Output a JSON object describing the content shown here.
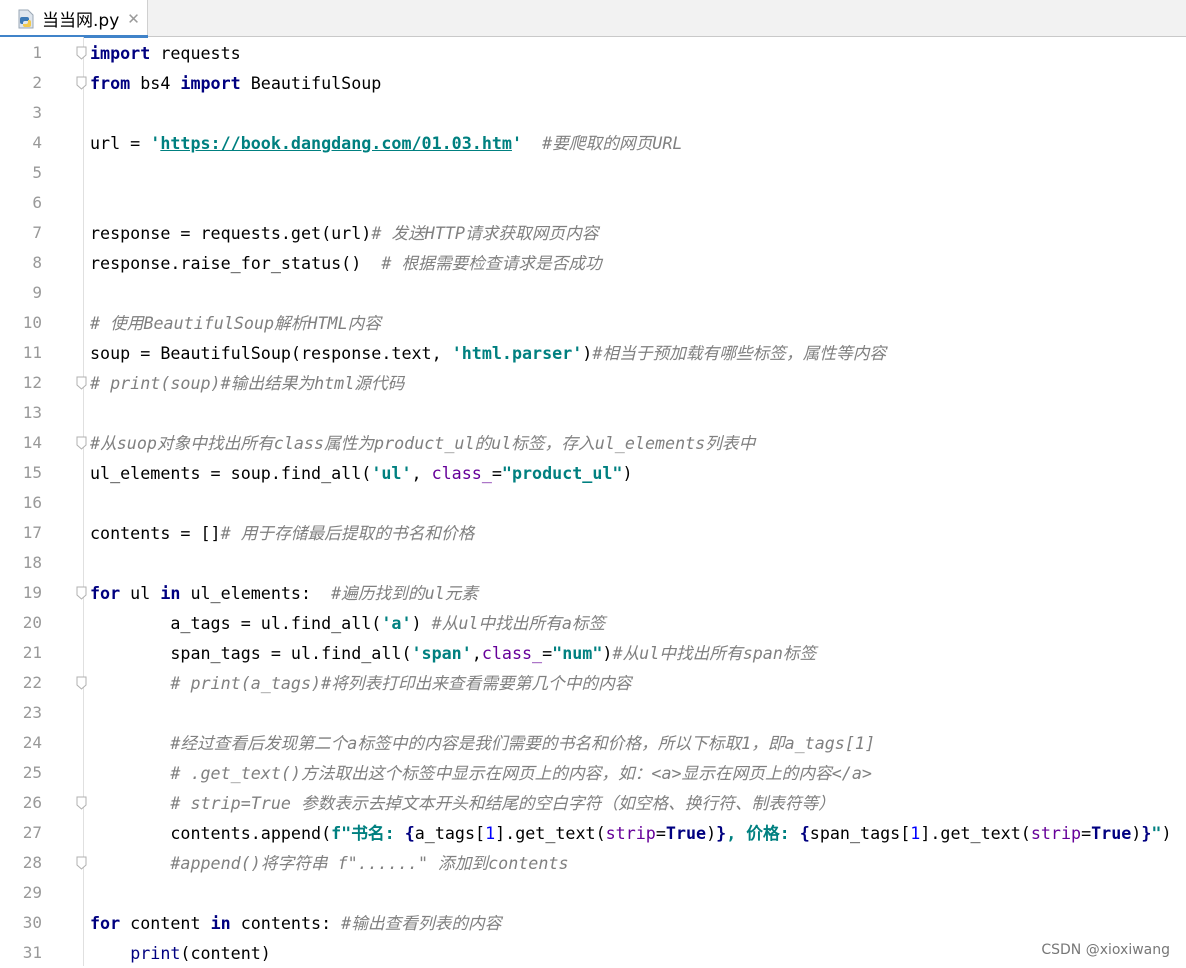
{
  "tab": {
    "title": "当当网.py",
    "icon": "python-file-icon"
  },
  "watermark": "CSDN @xioxiwang",
  "lines": [
    {
      "n": "1",
      "fold": true,
      "parts": [
        {
          "c": "kw",
          "t": "import"
        },
        {
          "c": "",
          "t": " requests"
        }
      ]
    },
    {
      "n": "2",
      "fold": true,
      "parts": [
        {
          "c": "kw",
          "t": "from"
        },
        {
          "c": "",
          "t": " bs4 "
        },
        {
          "c": "kw",
          "t": "import"
        },
        {
          "c": "",
          "t": " BeautifulSoup"
        }
      ]
    },
    {
      "n": "3",
      "fold": false,
      "parts": []
    },
    {
      "n": "4",
      "fold": false,
      "parts": [
        {
          "c": "",
          "t": "url = "
        },
        {
          "c": "str",
          "t": "'"
        },
        {
          "c": "url",
          "t": "https://book.dangdang.com/01.03.htm"
        },
        {
          "c": "str",
          "t": "'"
        },
        {
          "c": "",
          "t": "  "
        },
        {
          "c": "cm",
          "t": "#要爬取的网页URL"
        }
      ]
    },
    {
      "n": "5",
      "fold": false,
      "parts": []
    },
    {
      "n": "6",
      "fold": false,
      "parts": []
    },
    {
      "n": "7",
      "fold": false,
      "parts": [
        {
          "c": "",
          "t": "response = requests.get(url)"
        },
        {
          "c": "cm",
          "t": "# 发送HTTP请求获取网页内容"
        }
      ]
    },
    {
      "n": "8",
      "fold": false,
      "parts": [
        {
          "c": "",
          "t": "response.raise_for_status()  "
        },
        {
          "c": "cm",
          "t": "# 根据需要检查请求是否成功"
        }
      ]
    },
    {
      "n": "9",
      "fold": false,
      "parts": []
    },
    {
      "n": "10",
      "fold": false,
      "parts": [
        {
          "c": "cm",
          "t": "# 使用BeautifulSoup解析HTML内容"
        }
      ]
    },
    {
      "n": "11",
      "fold": false,
      "parts": [
        {
          "c": "",
          "t": "soup = BeautifulSoup(response.text, "
        },
        {
          "c": "str",
          "t": "'html.parser'"
        },
        {
          "c": "",
          "t": ")"
        },
        {
          "c": "cm",
          "t": "#相当于预加载有哪些标签，属性等内容"
        }
      ]
    },
    {
      "n": "12",
      "fold": true,
      "parts": [
        {
          "c": "cm",
          "t": "# print(soup)#输出结果为html源代码"
        }
      ]
    },
    {
      "n": "13",
      "fold": false,
      "parts": []
    },
    {
      "n": "14",
      "fold": true,
      "parts": [
        {
          "c": "cm",
          "t": "#从suop对象中找出所有class属性为product_ul的ul标签，存入ul_elements列表中"
        }
      ]
    },
    {
      "n": "15",
      "fold": false,
      "parts": [
        {
          "c": "",
          "t": "ul_elements = soup.find_all("
        },
        {
          "c": "str",
          "t": "'ul'"
        },
        {
          "c": "",
          "t": ", "
        },
        {
          "c": "kwa",
          "t": "class_"
        },
        {
          "c": "",
          "t": "="
        },
        {
          "c": "str",
          "t": "\"product_ul\""
        },
        {
          "c": "",
          "t": ")"
        }
      ]
    },
    {
      "n": "16",
      "fold": false,
      "parts": []
    },
    {
      "n": "17",
      "fold": false,
      "parts": [
        {
          "c": "",
          "t": "contents = []"
        },
        {
          "c": "cm",
          "t": "# 用于存储最后提取的书名和价格"
        }
      ]
    },
    {
      "n": "18",
      "fold": false,
      "parts": []
    },
    {
      "n": "19",
      "fold": true,
      "parts": [
        {
          "c": "kw",
          "t": "for"
        },
        {
          "c": "",
          "t": " ul "
        },
        {
          "c": "kw",
          "t": "in"
        },
        {
          "c": "",
          "t": " ul_elements:  "
        },
        {
          "c": "cm",
          "t": "#遍历找到的ul元素"
        }
      ]
    },
    {
      "n": "20",
      "fold": false,
      "parts": [
        {
          "c": "",
          "t": "        a_tags = ul.find_all("
        },
        {
          "c": "str",
          "t": "'a'"
        },
        {
          "c": "",
          "t": ") "
        },
        {
          "c": "cm",
          "t": "#从ul中找出所有a标签"
        }
      ]
    },
    {
      "n": "21",
      "fold": false,
      "parts": [
        {
          "c": "",
          "t": "        span_tags = ul.find_all("
        },
        {
          "c": "str",
          "t": "'span'"
        },
        {
          "c": "",
          "t": ","
        },
        {
          "c": "kwa",
          "t": "class_"
        },
        {
          "c": "",
          "t": "="
        },
        {
          "c": "str",
          "t": "\"num\""
        },
        {
          "c": "",
          "t": ")"
        },
        {
          "c": "cm",
          "t": "#从ul中找出所有span标签"
        }
      ]
    },
    {
      "n": "22",
      "fold": true,
      "parts": [
        {
          "c": "cm",
          "t": "        # print(a_tags)#将列表打印出来查看需要第几个中的内容"
        }
      ]
    },
    {
      "n": "23",
      "fold": false,
      "parts": []
    },
    {
      "n": "24",
      "fold": false,
      "parts": [
        {
          "c": "cm",
          "t": "        #经过查看后发现第二个a标签中的内容是我们需要的书名和价格，所以下标取1，即a_tags[1]"
        }
      ]
    },
    {
      "n": "25",
      "fold": false,
      "parts": [
        {
          "c": "cm",
          "t": "        # .get_text()方法取出这个标签中显示在网页上的内容，如：<a>显示在网页上的内容</a>"
        }
      ]
    },
    {
      "n": "26",
      "fold": true,
      "parts": [
        {
          "c": "cm",
          "t": "        # strip=True 参数表示去掉文本开头和结尾的空白字符（如空格、换行符、制表符等）"
        }
      ]
    },
    {
      "n": "27",
      "fold": false,
      "parts": [
        {
          "c": "",
          "t": "        contents.append("
        },
        {
          "c": "str",
          "t": "f\"书名: "
        },
        {
          "c": "tr",
          "t": "{"
        },
        {
          "c": "",
          "t": "a_tags["
        },
        {
          "c": "num",
          "t": "1"
        },
        {
          "c": "",
          "t": "].get_text("
        },
        {
          "c": "kwa",
          "t": "strip"
        },
        {
          "c": "",
          "t": "="
        },
        {
          "c": "kw",
          "t": "True"
        },
        {
          "c": "",
          "t": ")"
        },
        {
          "c": "tr",
          "t": "}"
        },
        {
          "c": "str",
          "t": ", 价格: "
        },
        {
          "c": "tr",
          "t": "{"
        },
        {
          "c": "",
          "t": "span_tags["
        },
        {
          "c": "num",
          "t": "1"
        },
        {
          "c": "",
          "t": "].get_text("
        },
        {
          "c": "kwa",
          "t": "strip"
        },
        {
          "c": "",
          "t": "="
        },
        {
          "c": "kw",
          "t": "True"
        },
        {
          "c": "",
          "t": ")"
        },
        {
          "c": "tr",
          "t": "}"
        },
        {
          "c": "str",
          "t": "\""
        },
        {
          "c": "",
          "t": ")"
        }
      ]
    },
    {
      "n": "28",
      "fold": true,
      "parts": [
        {
          "c": "cm",
          "t": "        #append()将字符串 f\"......\" 添加到contents"
        }
      ]
    },
    {
      "n": "29",
      "fold": false,
      "parts": []
    },
    {
      "n": "30",
      "fold": false,
      "parts": [
        {
          "c": "kw",
          "t": "for"
        },
        {
          "c": "",
          "t": " content "
        },
        {
          "c": "kw",
          "t": "in"
        },
        {
          "c": "",
          "t": " contents: "
        },
        {
          "c": "cm",
          "t": "#输出查看列表的内容"
        }
      ]
    },
    {
      "n": "31",
      "fold": false,
      "parts": [
        {
          "c": "",
          "t": "    "
        },
        {
          "c": "fn",
          "t": "print"
        },
        {
          "c": "",
          "t": "(content)"
        }
      ]
    }
  ]
}
